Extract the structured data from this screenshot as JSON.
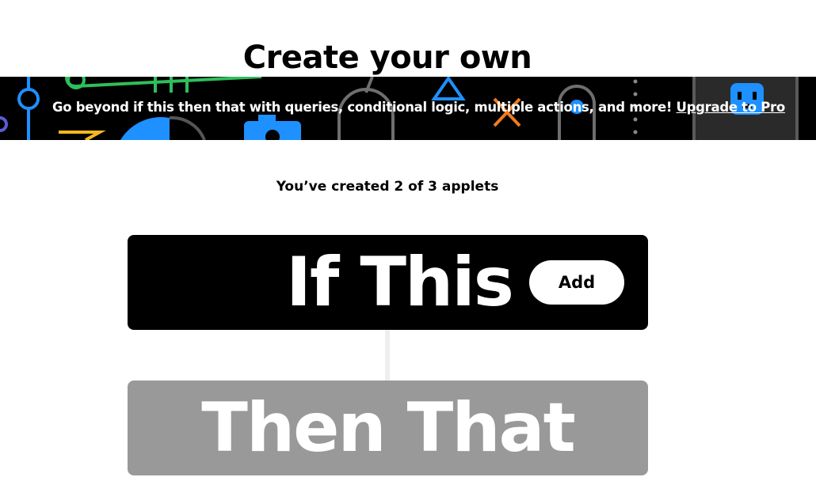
{
  "page": {
    "title": "Create your own"
  },
  "banner": {
    "text": "Go beyond if this then that with queries, conditional logic, multiple actions, and more!",
    "link_label": "Upgrade to Pro"
  },
  "applets": {
    "count_text": "You’ve created 2 of 3 applets"
  },
  "builder": {
    "if_label": "If This",
    "add_label": "Add",
    "then_label": "Then That"
  },
  "colors": {
    "banner_bg": "#000000",
    "if_card_bg": "#000000",
    "then_card_bg": "#999999",
    "connector": "#eeeeee",
    "deco_green": "#2fbf5a",
    "deco_blue": "#1e90ff",
    "deco_orange": "#f07b1f",
    "deco_yellow": "#f5b820",
    "deco_gray": "#6e6e6e"
  }
}
